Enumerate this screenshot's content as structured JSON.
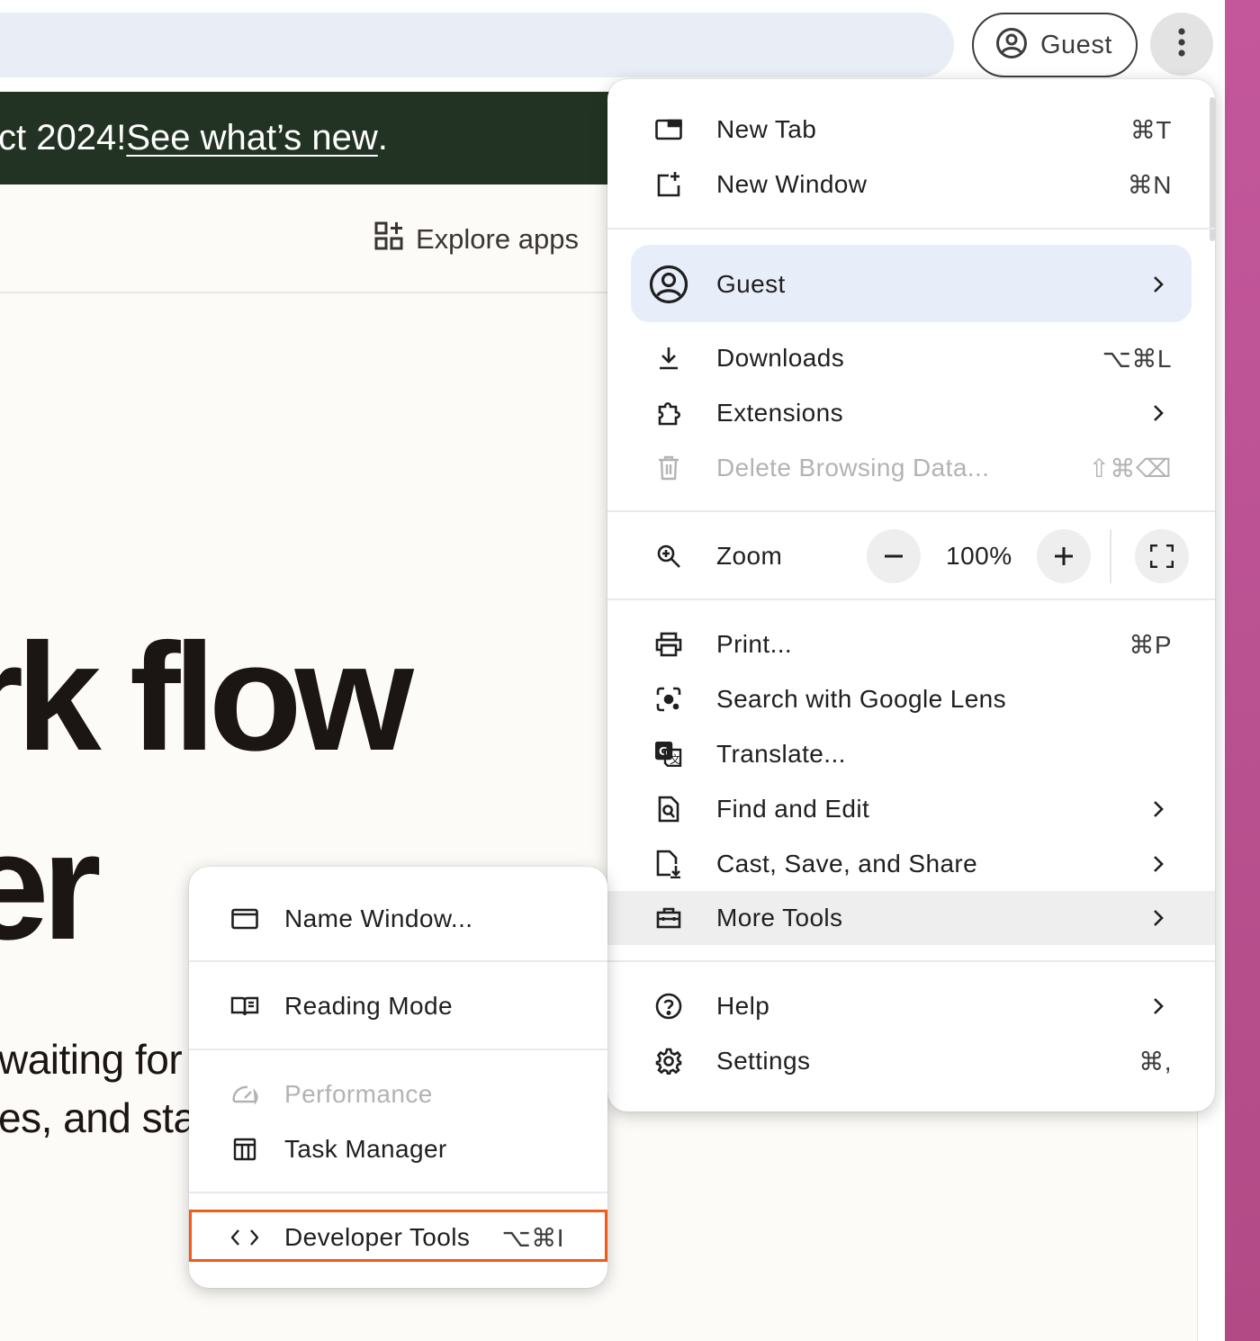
{
  "toolbar": {
    "profile_label": "Guest"
  },
  "page": {
    "banner_prefix": "ct 2024! ",
    "banner_link": "See what’s new",
    "banner_suffix": ".",
    "explore_label": "Explore apps",
    "hero_line_1": "rk flow",
    "hero_line_2": "er",
    "sub_line_1": "waiting for",
    "sub_line_2": "es, and sta"
  },
  "menu": {
    "new_tab": {
      "label": "New Tab",
      "shortcut": "⌘T"
    },
    "new_window": {
      "label": "New Window",
      "shortcut": "⌘N"
    },
    "guest": {
      "label": "Guest"
    },
    "downloads": {
      "label": "Downloads",
      "shortcut": "⌥⌘L"
    },
    "extensions": {
      "label": "Extensions"
    },
    "delete_data": {
      "label": "Delete Browsing Data...",
      "shortcut": "⇧⌘⌫"
    },
    "zoom": {
      "label": "Zoom",
      "value": "100%",
      "minus": "−",
      "plus": "+"
    },
    "print": {
      "label": "Print...",
      "shortcut": "⌘P"
    },
    "lens": {
      "label": "Search with Google Lens"
    },
    "translate": {
      "label": "Translate..."
    },
    "find_edit": {
      "label": "Find and Edit"
    },
    "cast": {
      "label": "Cast, Save, and Share"
    },
    "more_tools": {
      "label": "More Tools"
    },
    "help": {
      "label": "Help"
    },
    "settings": {
      "label": "Settings",
      "shortcut": "⌘,"
    }
  },
  "submenu": {
    "name_window": {
      "label": "Name Window..."
    },
    "reading_mode": {
      "label": "Reading Mode"
    },
    "performance": {
      "label": "Performance"
    },
    "task_manager": {
      "label": "Task Manager"
    },
    "developer_tools": {
      "label": "Developer Tools",
      "shortcut": "⌥⌘I"
    }
  },
  "colors": {
    "highlight_outline": "#f15a1a",
    "banner_bg": "#223323",
    "guest_row_bg": "#e8eef9",
    "desktop": "#c4579c"
  },
  "icons": {
    "profile": "account-circle-icon",
    "kebab": "more-vert-icon"
  }
}
